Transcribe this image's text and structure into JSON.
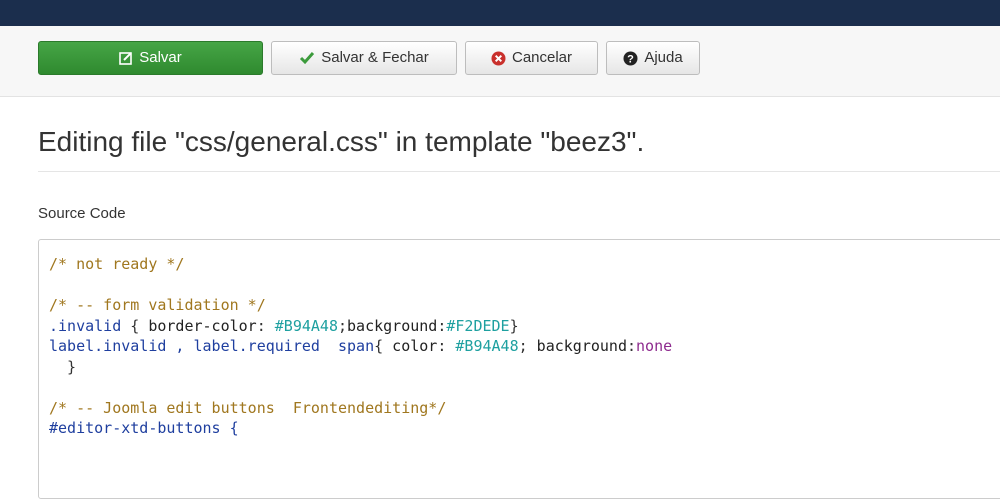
{
  "toolbar": {
    "save_label": "Salvar",
    "save_close_label": "Salvar & Fechar",
    "cancel_label": "Cancelar",
    "help_label": "Ajuda"
  },
  "page": {
    "title": "Editing file \"css/general.css\" in template \"beez3\"."
  },
  "editor": {
    "label": "Source Code",
    "lines": [
      [
        {
          "t": "/* not ready */",
          "c": "comment"
        }
      ],
      [],
      [
        {
          "t": "/* -- form validation */",
          "c": "comment"
        }
      ],
      [
        {
          "t": ".invalid",
          "c": "selector"
        },
        {
          "t": " { ",
          "c": "punct"
        },
        {
          "t": "border-color",
          "c": "prop"
        },
        {
          "t": ": ",
          "c": "punct"
        },
        {
          "t": "#B94A48",
          "c": "value"
        },
        {
          "t": ";",
          "c": "punct"
        },
        {
          "t": "background",
          "c": "prop"
        },
        {
          "t": ":",
          "c": "punct"
        },
        {
          "t": "#F2DEDE",
          "c": "value"
        },
        {
          "t": "}",
          "c": "punct"
        }
      ],
      [
        {
          "t": "label.invalid , label.required  span",
          "c": "selector"
        },
        {
          "t": "{ ",
          "c": "punct"
        },
        {
          "t": "color",
          "c": "prop"
        },
        {
          "t": ": ",
          "c": "punct"
        },
        {
          "t": "#B94A48",
          "c": "value"
        },
        {
          "t": "; ",
          "c": "punct"
        },
        {
          "t": "background",
          "c": "prop"
        },
        {
          "t": ":",
          "c": "punct"
        },
        {
          "t": "none",
          "c": "keyword"
        }
      ],
      [
        {
          "t": "  }",
          "c": "punct"
        }
      ],
      [],
      [
        {
          "t": "/* -- Joomla edit buttons  Frontendediting*/",
          "c": "comment"
        }
      ],
      [
        {
          "t": "#editor-xtd-buttons {",
          "c": "selector"
        }
      ]
    ]
  },
  "colors": {
    "topbar": "#1b2e4d",
    "save_button": "#3c9b3c",
    "cancel_icon": "#c9302c"
  },
  "icons": {
    "save": "edit-icon",
    "save_close": "check-icon",
    "cancel": "cancel-icon",
    "help": "question-icon"
  }
}
